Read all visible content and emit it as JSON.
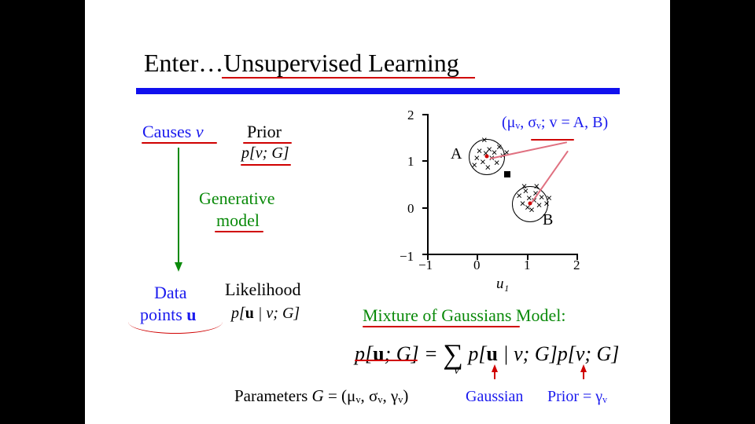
{
  "title_pre": "Enter…",
  "title_main": "Unsupervised Learning",
  "left": {
    "causes_label": "Causes ",
    "causes_var": "v",
    "prior_label": "Prior",
    "prior_expr": "p[v; G]",
    "gen_line1": "Generative",
    "gen_line2": "model",
    "data_line1": "Data",
    "data_line2": "points ",
    "data_u": "u",
    "likelihood_label": "Likelihood",
    "likelihood_expr_1": "p[",
    "likelihood_expr_u": "u",
    "likelihood_expr_2": " | v; G]"
  },
  "chart_data": {
    "type": "scatter",
    "xlabel": "u₁",
    "ylabel": "",
    "xlim": [
      -1,
      2
    ],
    "ylim": [
      -1,
      2
    ],
    "x_ticks": [
      -1,
      0,
      1,
      2
    ],
    "y_ticks": [
      -1,
      0,
      1,
      2
    ],
    "clusters": [
      {
        "name": "A",
        "mean": [
          0.2,
          1.1
        ],
        "radius": 0.35
      },
      {
        "name": "B",
        "mean": [
          1.1,
          0.1
        ],
        "radius": 0.35
      }
    ],
    "points": [
      [
        -0.05,
        0.9
      ],
      [
        0.0,
        1.05
      ],
      [
        0.05,
        1.2
      ],
      [
        0.12,
        0.98
      ],
      [
        0.18,
        1.15
      ],
      [
        0.22,
        0.85
      ],
      [
        0.25,
        1.25
      ],
      [
        0.3,
        1.05
      ],
      [
        0.35,
        1.18
      ],
      [
        0.4,
        0.95
      ],
      [
        0.15,
        1.45
      ],
      [
        0.45,
        1.3
      ],
      [
        0.52,
        1.1
      ],
      [
        0.6,
        1.18
      ],
      [
        0.85,
        0.25
      ],
      [
        0.92,
        0.08
      ],
      [
        0.98,
        0.35
      ],
      [
        1.02,
        0.0
      ],
      [
        1.05,
        0.2
      ],
      [
        1.1,
        -0.05
      ],
      [
        1.15,
        0.15
      ],
      [
        1.18,
        0.3
      ],
      [
        1.25,
        0.05
      ],
      [
        1.3,
        0.22
      ],
      [
        1.4,
        0.08
      ],
      [
        1.45,
        0.2
      ],
      [
        1.2,
        0.45
      ],
      [
        0.95,
        0.45
      ]
    ],
    "query_point": [
      0.65,
      0.72
    ],
    "annotation": "(μᵥ, σᵥ; v = A, B)"
  },
  "right": {
    "mog_label": "Mixture of Gaussians  Model:",
    "eq_left_1": "p[",
    "eq_left_u": "u",
    "eq_left_2": "; G] = ",
    "eq_sum": "∑",
    "eq_sum_sub": "v",
    "eq_mid_1": "p[",
    "eq_mid_u": "u",
    "eq_mid_2": " | v; G]",
    "eq_right": "p[v; G]",
    "gaussian_label": "Gaussian",
    "prior_label": "Prior  =  γᵥ"
  },
  "params": {
    "label": "Parameters  ",
    "var": "G",
    "eq": " = (μᵥ, σᵥ, γᵥ)"
  }
}
